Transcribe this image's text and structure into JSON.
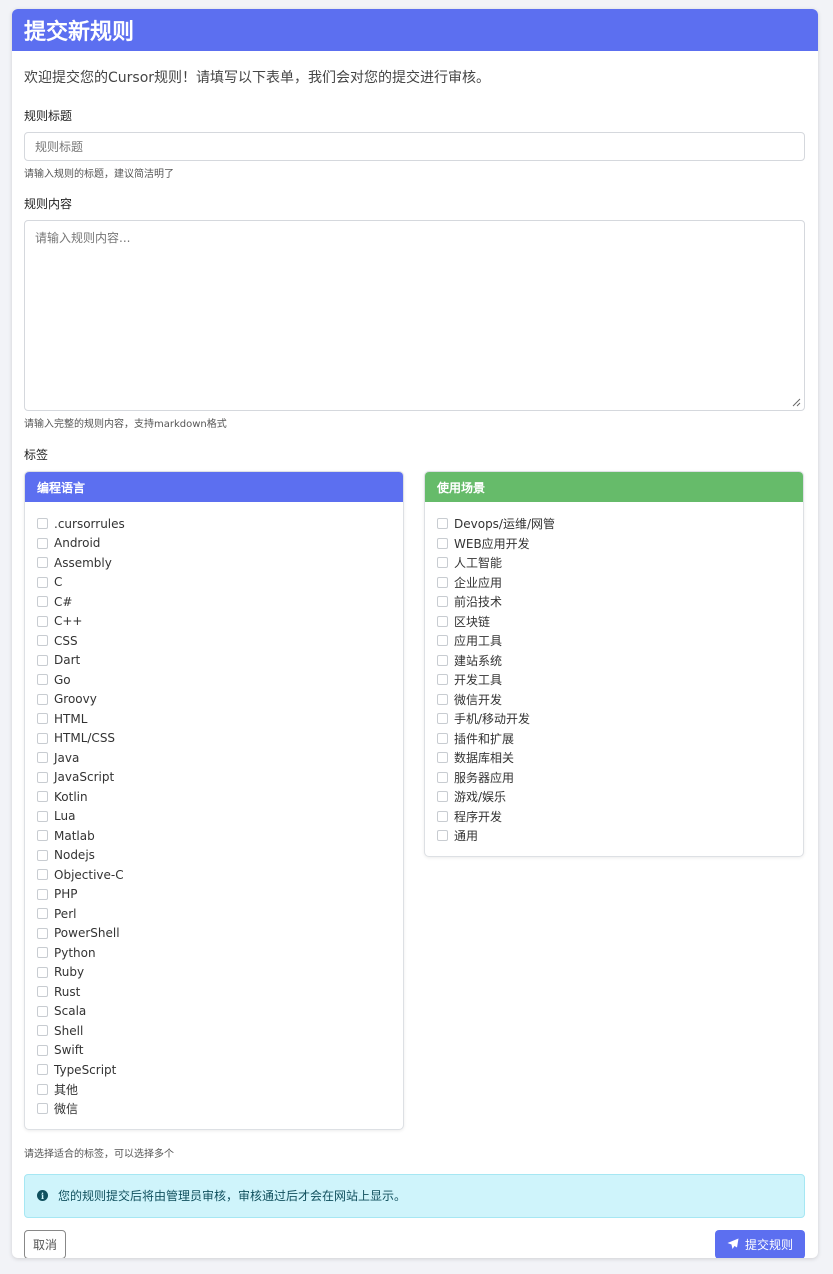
{
  "header": {
    "title": "提交新规则"
  },
  "intro": "欢迎提交您的Cursor规则！请填写以下表单，我们会对您的提交进行审核。",
  "title_field": {
    "label": "规则标题",
    "placeholder": "规则标题",
    "help": "请输入规则的标题，建议简洁明了"
  },
  "content_field": {
    "label": "规则内容",
    "placeholder": "请输入规则内容...",
    "help": "请输入完整的规则内容，支持markdown格式"
  },
  "tags": {
    "label": "标签",
    "help": "请选择适合的标签，可以选择多个",
    "languages": {
      "title": "编程语言",
      "color": "#5c6ff0",
      "items": [
        ".cursorrules",
        "Android",
        "Assembly",
        "C",
        "C#",
        "C++",
        "CSS",
        "Dart",
        "Go",
        "Groovy",
        "HTML",
        "HTML/CSS",
        "Java",
        "JavaScript",
        "Kotlin",
        "Lua",
        "Matlab",
        "Nodejs",
        "Objective-C",
        "PHP",
        "Perl",
        "PowerShell",
        "Python",
        "Ruby",
        "Rust",
        "Scala",
        "Shell",
        "Swift",
        "TypeScript",
        "其他",
        "微信"
      ]
    },
    "scenarios": {
      "title": "使用场景",
      "color": "#66bb6a",
      "items": [
        "Devops/运维/网管",
        "WEB应用开发",
        "人工智能",
        "企业应用",
        "前沿技术",
        "区块链",
        "应用工具",
        "建站系统",
        "开发工具",
        "微信开发",
        "手机/移动开发",
        "插件和扩展",
        "数据库相关",
        "服务器应用",
        "游戏/娱乐",
        "程序开发",
        "通用"
      ]
    }
  },
  "alert": {
    "text": "您的规则提交后将由管理员审核，审核通过后才会在网站上显示。",
    "icon": "info-icon"
  },
  "actions": {
    "cancel_label": "取消",
    "submit_label": "提交规则",
    "submit_icon": "paper-plane-icon"
  }
}
